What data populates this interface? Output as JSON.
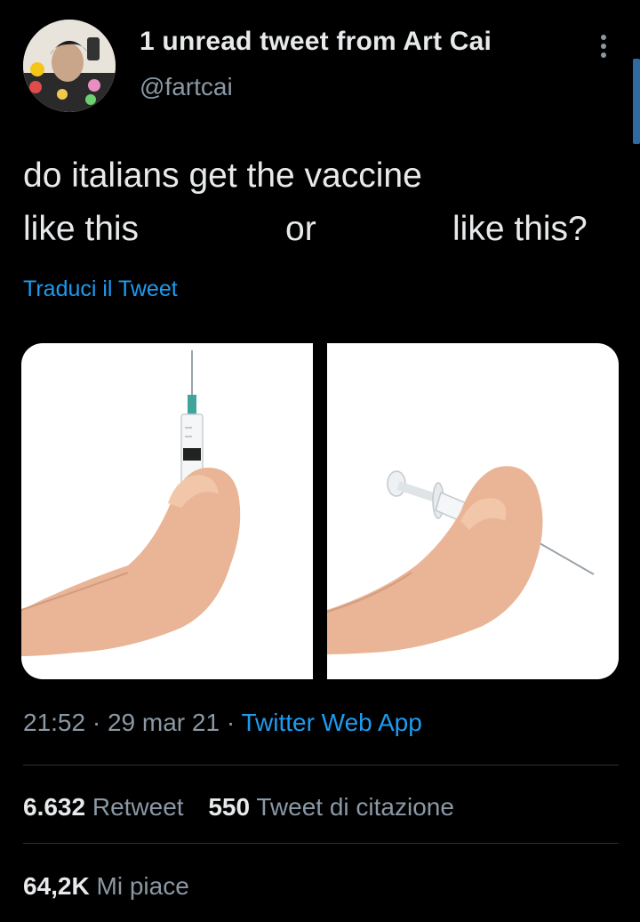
{
  "header": {
    "title": "1 unread tweet from Art Cai",
    "handle": "@fartcai"
  },
  "tweet": {
    "line1": "do italians get the vaccine",
    "line2_a": "like this",
    "line2_b": "or",
    "line2_c": "like this?",
    "translate_label": "Traduci il Tweet"
  },
  "meta": {
    "time": "21:52",
    "separator": "·",
    "date": "29 mar 21",
    "source": "Twitter Web App"
  },
  "stats": {
    "retweets_count": "6.632",
    "retweets_label": "Retweet",
    "quotes_count": "550",
    "quotes_label": "Tweet di citazione",
    "likes_count": "64,2K",
    "likes_label": "Mi piace"
  },
  "colors": {
    "background": "#000000",
    "link": "#1d9bf0",
    "secondary_text": "#8b98a5",
    "primary_text": "#e7e9ea"
  }
}
